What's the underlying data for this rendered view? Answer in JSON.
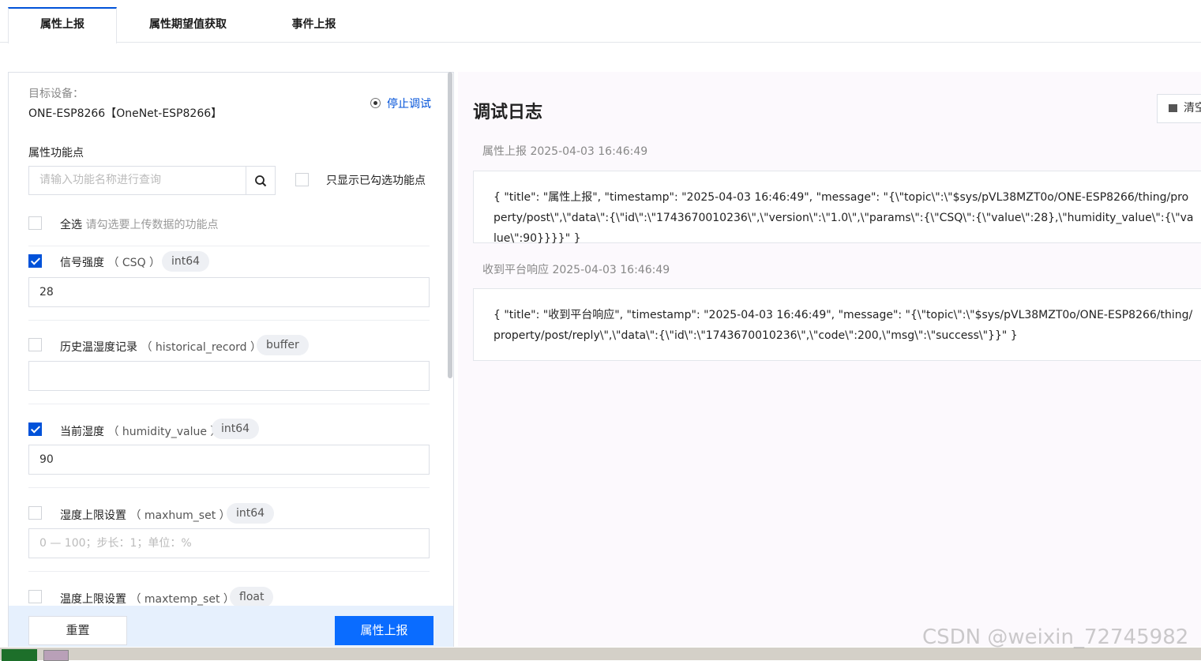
{
  "tabs": [
    {
      "label": "属性上报",
      "active": true
    },
    {
      "label": "属性期望值获取",
      "active": false
    },
    {
      "label": "事件上报",
      "active": false
    }
  ],
  "device": {
    "label": "目标设备：",
    "name": "ONE-ESP8266【OneNet-ESP8266】",
    "stop_debug": "停止调试"
  },
  "properties": {
    "section_label": "属性功能点",
    "search_placeholder": "请输入功能名称进行查询",
    "only_checked_label": "只显示已勾选功能点",
    "select_all_label": "全选",
    "select_all_hint": "请勾选要上传数据的功能点",
    "items": [
      {
        "name": "信号强度",
        "id": "（ CSQ ）",
        "type": "int64",
        "checked": true,
        "value": "28",
        "placeholder": ""
      },
      {
        "name": "历史温湿度记录",
        "id": "（ historical_record ）",
        "type": "buffer",
        "checked": false,
        "value": "",
        "placeholder": ""
      },
      {
        "name": "当前湿度",
        "id": "（ humidity_value ）",
        "type": "int64",
        "checked": true,
        "value": "90",
        "placeholder": ""
      },
      {
        "name": "湿度上限设置",
        "id": "（ maxhum_set ）",
        "type": "int64",
        "checked": false,
        "value": "",
        "placeholder": "0 — 100；步长：1；单位：%"
      },
      {
        "name": "温度上限设置",
        "id": "（ maxtemp_set ）",
        "type": "float",
        "checked": false,
        "value": "",
        "placeholder": ""
      }
    ]
  },
  "footer": {
    "reset_label": "重置",
    "submit_label": "属性上报"
  },
  "log": {
    "title": "调试日志",
    "clear_label": "清空",
    "entries": [
      {
        "header": "属性上报 2025-04-03 16:46:49",
        "body": "{ \"title\": \"属性上报\", \"timestamp\": \"2025-04-03 16:46:49\", \"message\": \"{\\\"topic\\\":\\\"$sys/pVL38MZT0o/ONE-ESP8266/thing/property/post\\\",\\\"data\\\":{\\\"id\\\":\\\"1743670010236\\\",\\\"version\\\":\\\"1.0\\\",\\\"params\\\":{\\\"CSQ\\\":{\\\"value\\\":28},\\\"humidity_value\\\":{\\\"value\\\":90}}}}\" }"
      },
      {
        "header": "收到平台响应 2025-04-03 16:46:49",
        "body": "{ \"title\": \"收到平台响应\", \"timestamp\": \"2025-04-03 16:46:49\", \"message\": \"{\\\"topic\\\":\\\"$sys/pVL38MZT0o/ONE-ESP8266/thing/property/post/reply\\\",\\\"data\\\":{\\\"id\\\":\\\"1743670010236\\\",\\\"code\\\":200,\\\"msg\\\":\\\"success\\\"}}\" }"
      }
    ]
  },
  "watermark": "CSDN @weixin_72745982",
  "colors": {
    "accent": "#0052d9",
    "button": "#0a6cff",
    "footer_bg": "#e6f0fd",
    "log_bg": "#fcf9fd"
  }
}
